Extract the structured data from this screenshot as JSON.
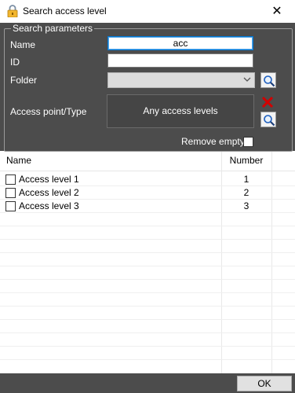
{
  "window": {
    "title": "Search access level",
    "close_glyph": "✕"
  },
  "search_parameters": {
    "legend": "Search parameters",
    "name_label": "Name",
    "name_value": "acc",
    "id_label": "ID",
    "id_value": "",
    "folder_label": "Folder",
    "folder_value": "",
    "access_point_label": "Access point/Type",
    "access_point_value": "Any access levels",
    "remove_empty_label": "Remove empty",
    "remove_empty_checked": false
  },
  "table": {
    "columns": [
      "Name",
      "Number"
    ],
    "rows": [
      {
        "name": "Access level 1",
        "number": "1",
        "checked": false
      },
      {
        "name": "Access level 2",
        "number": "2",
        "checked": false
      },
      {
        "name": "Access level 3",
        "number": "3",
        "checked": false
      }
    ]
  },
  "footer": {
    "ok_label": "OK"
  },
  "icons": [
    "lock-icon",
    "close-icon",
    "chevron-down-icon",
    "search-icon",
    "delete-icon"
  ],
  "colors": {
    "panel_bg": "#4c4c4c",
    "delete_red": "#d20000",
    "search_blue": "#1e5fbf"
  }
}
